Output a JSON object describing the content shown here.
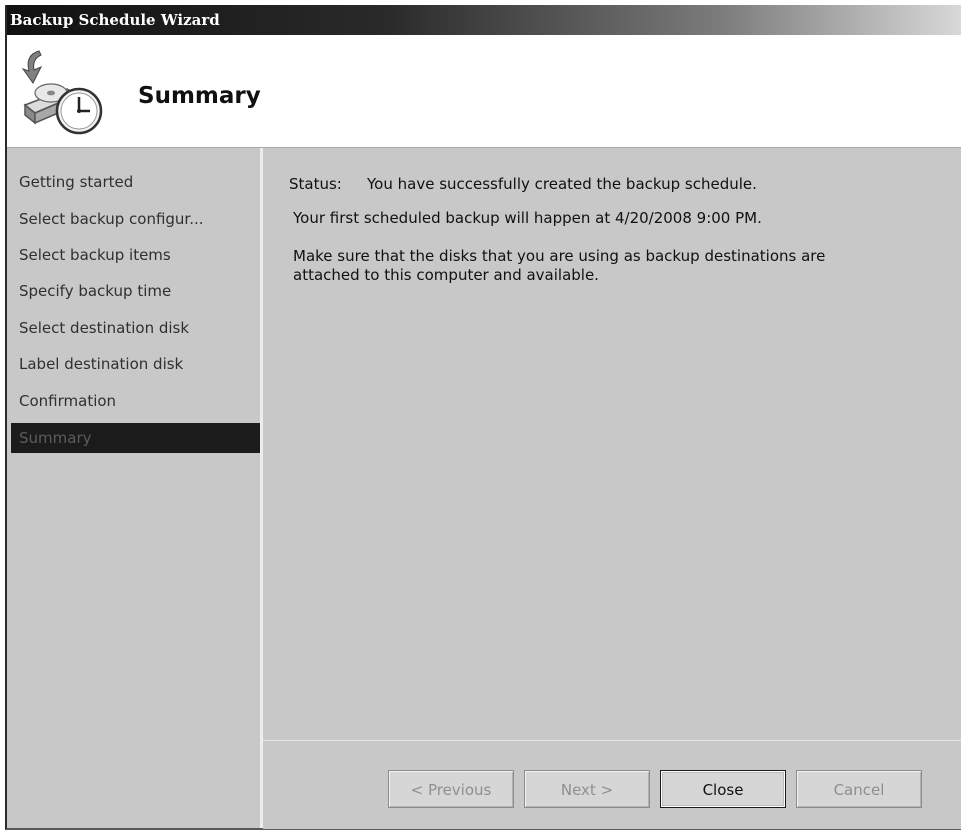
{
  "window": {
    "title": "Backup Schedule Wizard"
  },
  "header": {
    "title": "Summary",
    "icon": "backup-schedule-icon"
  },
  "nav": {
    "items": [
      {
        "label": "Getting started",
        "active": false
      },
      {
        "label": "Select backup configur...",
        "active": false
      },
      {
        "label": "Select backup items",
        "active": false
      },
      {
        "label": "Specify backup time",
        "active": false
      },
      {
        "label": "Select destination disk",
        "active": false
      },
      {
        "label": "Label destination disk",
        "active": false
      },
      {
        "label": "Confirmation",
        "active": false
      },
      {
        "label": "Summary",
        "active": true
      }
    ]
  },
  "content": {
    "status_label": "Status:",
    "status_text": "You have successfully created the backup schedule.",
    "schedule_text": "Your first scheduled backup will happen at 4/20/2008 9:00 PM.",
    "note_line1": "Make sure that the disks that you are using as backup destinations are",
    "note_line2": "attached to this computer and available."
  },
  "buttons": {
    "previous": {
      "label": "< Previous",
      "enabled": false
    },
    "next": {
      "label": "Next >",
      "enabled": false
    },
    "close": {
      "label": "Close",
      "enabled": true
    },
    "cancel": {
      "label": "Cancel",
      "enabled": false
    }
  }
}
